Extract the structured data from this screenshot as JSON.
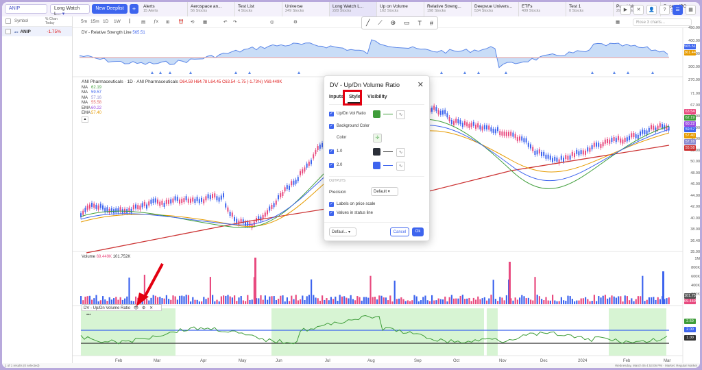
{
  "topbar": {
    "symbol": "ANIP",
    "watchlist": "Long Watch L...",
    "new_deeplist": "New Deeplist",
    "add": "+",
    "tabs": [
      {
        "name": "Alerts",
        "count": "15 Alerts"
      },
      {
        "name": "Aerospace an...",
        "count": "56 Stocks"
      },
      {
        "name": "Test List",
        "count": "4 Stocks"
      },
      {
        "name": "Universe",
        "count": "249 Stocks"
      },
      {
        "name": "Long Watch L...",
        "count": "228 Stocks"
      },
      {
        "name": "Up on Volume",
        "count": "162 Stocks"
      },
      {
        "name": "Relative Streng...",
        "count": "198 Stocks"
      },
      {
        "name": "Deepvue Univers...",
        "count": "534 Stocks"
      },
      {
        "name": "ETFs",
        "count": "409 Stocks"
      },
      {
        "name": "Test 1",
        "count": "0 Stocks"
      },
      {
        "name": "Pure Volume",
        "count": "295 Stocks"
      },
      {
        "name": "Recent IPO",
        "count": "196 Stocks"
      }
    ]
  },
  "left_panel": {
    "col_symbol": "Symbol",
    "col_change": "% Chan Today",
    "row": {
      "symbol": "ANIP",
      "change": "-1.75%"
    },
    "footer": "1 of 1 results (0 selected)"
  },
  "toolbar": {
    "intervals": [
      "5m",
      "15m",
      "1D",
      "1W"
    ],
    "layout_placeholder": "Rose 3 charts..."
  },
  "rs_panel": {
    "title": "DV - Relative Strength Line",
    "value": "565.51",
    "axis": [
      "450.00",
      "400.00",
      "350.00",
      "300.00",
      "270.00"
    ],
    "labels": [
      {
        "text": "565.51",
        "color": "#3d64ee"
      },
      {
        "text": "361.44",
        "color": "#e69b00"
      }
    ]
  },
  "price_panel": {
    "title": "ANI Pharmaceuticals · 1D · ANI Pharmaceuticals",
    "ohlc": "O64.59 H64.78 L64.45 C63.54 -1.75 (-1.73%)",
    "vol": "V69.449K",
    "mas": [
      {
        "label": "MA",
        "value": "62.19",
        "color": "#3f9d3a"
      },
      {
        "label": "MA",
        "value": "59.57",
        "color": "#3d64ee"
      },
      {
        "label": "MA",
        "value": "57.16",
        "color": "#8a8ad0"
      },
      {
        "label": "MA",
        "value": "55.58",
        "color": "#e06060"
      },
      {
        "label": "EMA",
        "value": "60.22",
        "color": "#9b4de3"
      },
      {
        "label": "EMA",
        "value": "57.40",
        "color": "#e69b00"
      }
    ],
    "axis": [
      "71.00",
      "67.00",
      "63.00",
      "59.00",
      "56.00",
      "53.00",
      "50.00",
      "48.00",
      "46.00",
      "44.00",
      "42.00",
      "40.00",
      "38.00",
      "36.40",
      "35.00"
    ],
    "price_tags": [
      {
        "text": "63.54",
        "color": "#e84a7f"
      },
      {
        "text": "62.19",
        "color": "#3f9d3a"
      },
      {
        "text": "60.22",
        "color": "#9b4de3"
      },
      {
        "text": "59.57",
        "color": "#3d64ee"
      },
      {
        "text": "57.40",
        "color": "#e69b00"
      },
      {
        "text": "57.16",
        "color": "#8a8ad0"
      },
      {
        "text": "55.58",
        "color": "#cc3333"
      }
    ]
  },
  "volume_panel": {
    "title": "Volume",
    "value1": "69.449K",
    "value2": "101.752K",
    "axis": [
      "1M",
      "800K",
      "600K",
      "400K",
      "200K"
    ],
    "tags": [
      {
        "text": "101.752K",
        "color": "#555"
      },
      {
        "text": "69.449K",
        "color": "#e84a7f"
      }
    ]
  },
  "indicator_panel": {
    "title": "DV - Up/Dn Volume Ratio",
    "tags": [
      {
        "text": "2.59",
        "color": "#3f9d3a"
      },
      {
        "text": "2.00",
        "color": "#3d64ee"
      },
      {
        "text": "1.00",
        "color": "#333333"
      }
    ]
  },
  "x_axis": [
    "Feb",
    "Mar",
    "Apr",
    "May",
    "Jun",
    "Jul",
    "Aug",
    "Sep",
    "Oct",
    "Nov",
    "Dec",
    "2024",
    "Feb",
    "Mar"
  ],
  "dialog": {
    "title": "DV - Up/Dn Volume Ratio",
    "tabs": [
      "Inputs",
      "Style",
      "Visibility"
    ],
    "rows": {
      "updn": "Up/Dn Vol Ratio",
      "bg": "Background Color",
      "color": "Color",
      "lvl1": "1.0",
      "lvl2": "2.0"
    },
    "section": "OUTPUTS",
    "precision_label": "Precision",
    "precision_value": "Default",
    "labels_scale": "Labels on price scale",
    "values_status": "Values in status line",
    "defaults": "Defaul...",
    "cancel": "Cancel",
    "ok": "Ok"
  },
  "status_bar": {
    "left": "1 of 1 results (0 selected)",
    "right": "Wednesday, March 06 4:53:06 PM · Market: Regular Market"
  }
}
